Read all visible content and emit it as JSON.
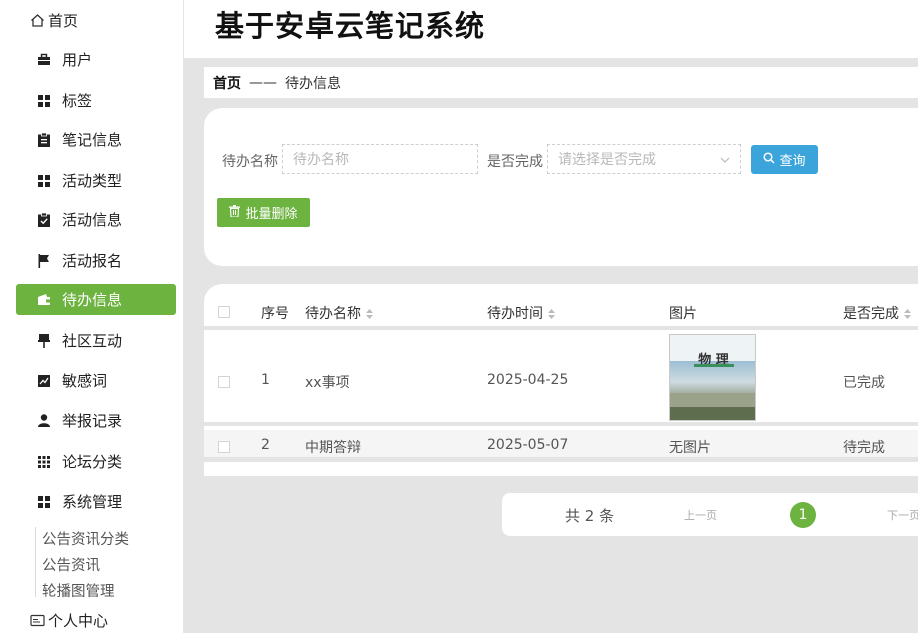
{
  "app": {
    "title": "基于安卓云笔记系统"
  },
  "sidebar": {
    "home": "首页",
    "items": [
      {
        "label": "用户",
        "icon": "briefcase-icon"
      },
      {
        "label": "标签",
        "icon": "grid-icon"
      },
      {
        "label": "笔记信息",
        "icon": "clipboard-icon"
      },
      {
        "label": "活动类型",
        "icon": "grid-icon"
      },
      {
        "label": "活动信息",
        "icon": "clipboard-check-icon"
      },
      {
        "label": "活动报名",
        "icon": "flag-icon"
      },
      {
        "label": "待办信息",
        "icon": "wallet-icon"
      },
      {
        "label": "社区互动",
        "icon": "pushpin-icon"
      },
      {
        "label": "敏感词",
        "icon": "chart-icon"
      },
      {
        "label": "举报记录",
        "icon": "user-icon"
      },
      {
        "label": "论坛分类",
        "icon": "apps-icon"
      },
      {
        "label": "系统管理",
        "icon": "grid-icon"
      }
    ],
    "sub_items": [
      "公告资讯分类",
      "公告资讯",
      "轮播图管理"
    ],
    "personal": "个人中心",
    "active_color": "#6db33f"
  },
  "breadcrumb": {
    "home": "首页",
    "separator": "——",
    "current": "待办信息"
  },
  "search": {
    "name_label": "待办名称",
    "name_placeholder": "待办名称",
    "done_label": "是否完成",
    "done_placeholder": "请选择是否完成",
    "query_button": "查询",
    "batch_delete_button": "批量删除"
  },
  "table": {
    "columns": [
      "序号",
      "待办名称",
      "待办时间",
      "图片",
      "是否完成"
    ],
    "rows": [
      {
        "index": "1",
        "name": "xx事项",
        "time": "2025-04-25",
        "image_title": "物 理",
        "done": "已完成"
      },
      {
        "index": "2",
        "name": "中期答辩",
        "time": "2025-05-07",
        "image_text": "无图片",
        "done": "待完成"
      }
    ]
  },
  "pager": {
    "total": "共 2 条",
    "prev": "上一页",
    "current": "1",
    "next": "下一页"
  },
  "colors": {
    "primary_green": "#6db33f",
    "query_blue": "#3ba5db"
  }
}
